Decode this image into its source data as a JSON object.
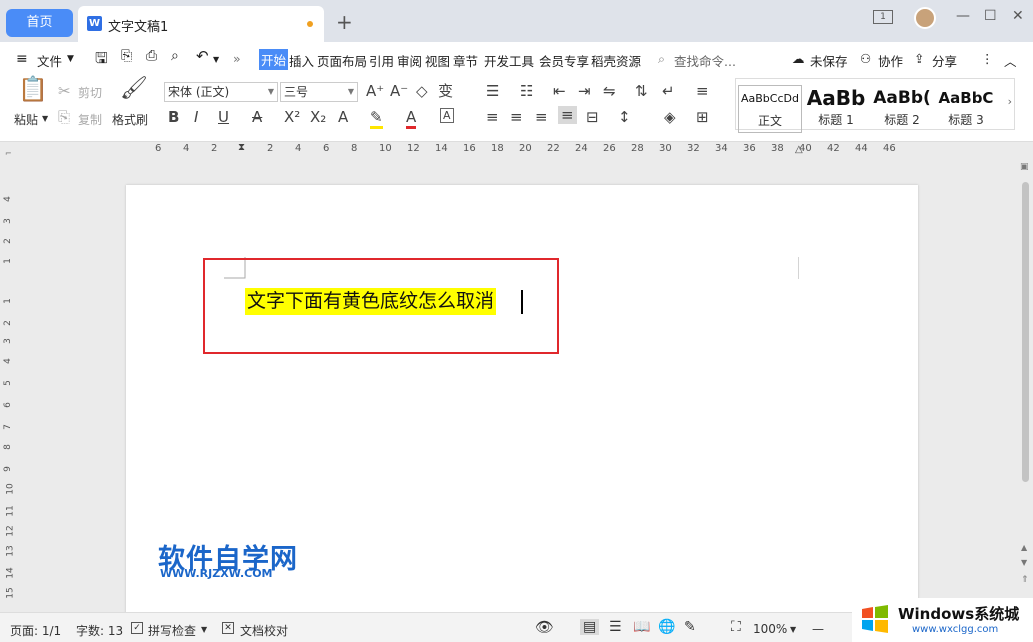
{
  "tabs": {
    "home": "首页",
    "doc_title": "文字文稿1",
    "new_tab": "+"
  },
  "window_controls": {
    "minimize": "—",
    "maximize": "☐",
    "close": "✕"
  },
  "menu": {
    "file": "文件",
    "items": [
      "开始",
      "插入",
      "页面布局",
      "引用",
      "审阅",
      "视图",
      "章节",
      "开发工具",
      "会员专享",
      "稻壳资源"
    ],
    "search": "查找命令...",
    "unsaved": "未保存",
    "collab": "协作",
    "share": "分享"
  },
  "ribbon": {
    "paste": "粘贴",
    "cut": "剪切",
    "copy": "复制",
    "format_painter": "格式刷",
    "font_name": "宋体 (正文)",
    "font_size": "三号",
    "styles": [
      {
        "sample": "AaBbCcDd",
        "name": "正文"
      },
      {
        "sample": "AaBb",
        "name": "标题 1"
      },
      {
        "sample": "AaBb(",
        "name": "标题 2"
      },
      {
        "sample": "AaBbC",
        "name": "标题 3"
      }
    ]
  },
  "ruler": {
    "h_ticks": [
      "6",
      "4",
      "2",
      "2",
      "4",
      "6",
      "8",
      "10",
      "12",
      "14",
      "16",
      "18",
      "20",
      "22",
      "24",
      "26",
      "28",
      "30",
      "32",
      "34",
      "36",
      "38",
      "40",
      "42",
      "44",
      "46"
    ],
    "v_ticks": [
      "4",
      "3",
      "2",
      "1",
      "1",
      "2",
      "3",
      "4",
      "5",
      "6",
      "7",
      "8",
      "9",
      "10",
      "11",
      "12",
      "13",
      "14",
      "15"
    ]
  },
  "document": {
    "text": "文字下面有黄色底纹怎么取消",
    "highlight_color": "#ffff00"
  },
  "watermark": {
    "title": "软件自学网",
    "url": "WWW.RJZXW.COM"
  },
  "status": {
    "page": "页面: 1/1",
    "words": "字数: 13",
    "spell": "拼写检查",
    "proof": "文档校对",
    "zoom": "100%"
  },
  "overlay_logo": {
    "title": "Windows系统城",
    "url": "www.wxclgg.com"
  },
  "colors": {
    "accent": "#4a8cf7",
    "annotation_box": "#e0282c",
    "watermark": "#1b66c9"
  }
}
